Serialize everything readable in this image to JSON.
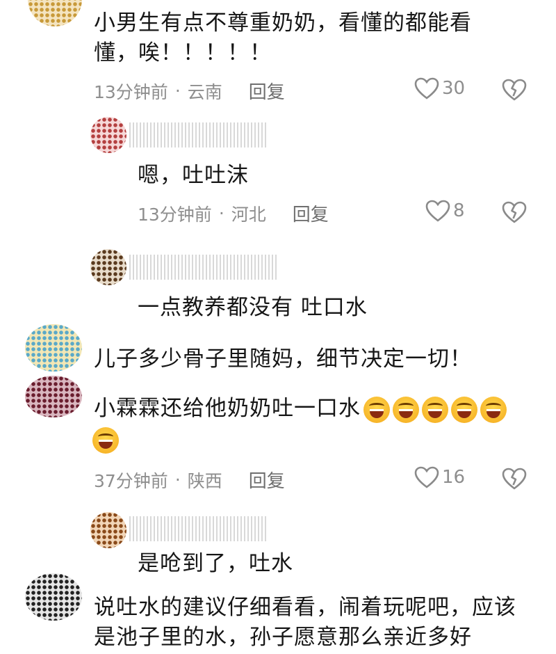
{
  "icons": {
    "like": "heart-outline-icon",
    "dislike": "broken-heart-icon"
  },
  "comments": [
    {
      "text": "小男生有点不尊重奶奶，看懂的都能看懂，唉！！！！！",
      "time": "13分钟前",
      "region": "云南",
      "reply": "回复",
      "likes": "30"
    },
    {
      "text": "嗯，吐吐沫",
      "time": "13分钟前",
      "region": "河北",
      "reply": "回复",
      "likes": "8"
    },
    {
      "text": "一点教养都没有 吐口水"
    },
    {
      "text": "儿子多少骨子里随妈，细节决定一切！"
    },
    {
      "text": "小霖霖还给他奶奶吐一口水",
      "time": "37分钟前",
      "region": "陕西",
      "reply": "回复",
      "likes": "16"
    },
    {
      "text": "是呛到了，吐水"
    },
    {
      "text": "说吐水的建议仔细看看，闹着玩呢吧，应该是池子里的水，孙子愿意那么亲近多好"
    }
  ],
  "meta_separator": "·"
}
